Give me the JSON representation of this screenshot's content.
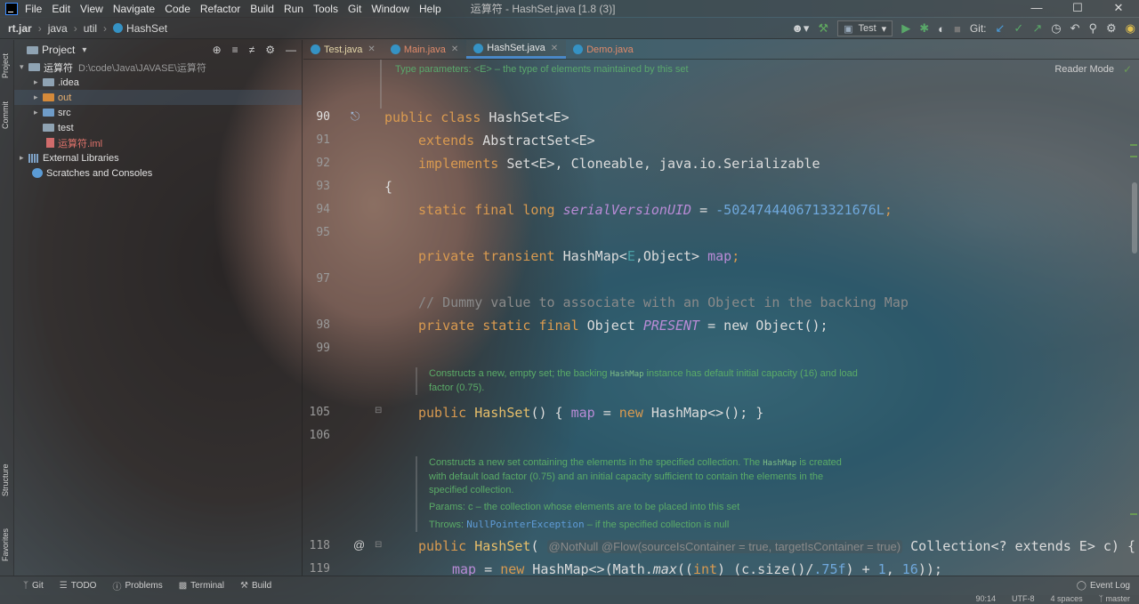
{
  "menubar": {
    "items": [
      "File",
      "Edit",
      "View",
      "Navigate",
      "Code",
      "Refactor",
      "Build",
      "Run",
      "Tools",
      "Git",
      "Window",
      "Help"
    ],
    "window_title": "运算符 - HashSet.java [1.8 (3)]"
  },
  "navbar": {
    "crumbs": [
      "rt.jar",
      "java",
      "util",
      "HashSet"
    ],
    "run_config": "Test",
    "git_label": "Git:"
  },
  "left_stripe": {
    "project": "Project",
    "commit": "Commit",
    "structure": "Structure",
    "favorites": "Favorites"
  },
  "project_panel": {
    "title": "Project",
    "root": {
      "name": "运算符",
      "path": "D:\\code\\Java\\JAVASE\\运算符"
    },
    "children": [
      ".idea",
      "out",
      "src",
      "test",
      "运算符.iml"
    ],
    "external_libraries": "External Libraries",
    "scratches": "Scratches and Consoles"
  },
  "editor_tabs": [
    {
      "label": "Test.java"
    },
    {
      "label": "Main.java"
    },
    {
      "label": "HashSet.java",
      "active": true
    },
    {
      "label": "Demo.java"
    }
  ],
  "editor": {
    "doc_header": "Type parameters: <E> – the type of elements maintained by this set",
    "reader_mode": "Reader Mode",
    "line_numbers": {
      "l1": "90",
      "l2": "91",
      "l3": "92",
      "l4": "93",
      "l5": "94",
      "l6": "95",
      "l7": "97",
      "l8": "98",
      "l9": "99",
      "l10": "105",
      "l11": "106",
      "l12": "118",
      "l13": "119"
    },
    "code": {
      "public": "public",
      "class": "class",
      "class_name": "HashSet",
      "type_param": "<E>",
      "extends": "extends",
      "abstract_set": "AbstractSet",
      "e1": "<E>",
      "implements": "implements",
      "set": "Set",
      "e2": "<E>",
      "implements_rest": ", Cloneable, java.io.Serializable",
      "brace": "{",
      "static_final_long": "static final long",
      "serial_name": "serialVersionUID",
      "equals": " = ",
      "serial_value": "-5024744406713321676L",
      "semicolon": ";",
      "private_transient": "private transient",
      "hashmap_decl": "HashMap<",
      "e3": "E",
      "object_gt": ",Object>",
      "map_name": "map",
      "comment": "// Dummy value to associate with an Object in the backing Map",
      "private_static_final": "private static final",
      "object_type": "Object",
      "present_name": "PRESENT",
      "new_object": " = new Object();",
      "ctor_public": "public",
      "ctor_name": "HashSet",
      "ctor_rest_a": "() { ",
      "ctor_map": "map",
      "ctor_rest_b": " = ",
      "ctor_new": "new",
      "ctor_rest_c": " HashMap<>(); }",
      "ctor2_name": "HashSet",
      "ctor2_anno": "@NotNull @Flow(sourceIsContainer = true, targetIsContainer = true)",
      "ctor2_rest": " Collection<? extends E> c) {",
      "line119_map": "map",
      "line119_a": " = ",
      "line119_new": "new",
      "line119_b": " HashMap<>(Math.",
      "line119_max": "max",
      "line119_c": "((",
      "line119_int": "int",
      "line119_d": ") (c.size()/",
      "line119_f": ".75f",
      "line119_e": ") + ",
      "line119_one": "1",
      "line119_g": ", ",
      "line119_sixteen": "16",
      "line119_h": "));"
    },
    "doc1": {
      "a": "Constructs a new, empty set; the backing ",
      "code": "HashMap",
      "b": " instance has default initial capacity (16) and load factor (0.75)."
    },
    "doc2": {
      "a": "Constructs a new set containing the elements in the specified collection. The ",
      "code": "HashMap",
      "b": " is created with default load factor (0.75) and an initial capacity sufficient to contain the elements in the specified collection.",
      "params": "Params: c – the collection whose elements are to be placed into this set",
      "throws_a": "Throws: ",
      "throws_link": "NullPointerException",
      "throws_b": " – if the specified collection is null"
    }
  },
  "bottom_tools": [
    "Git",
    "TODO",
    "Problems",
    "Terminal",
    "Build"
  ],
  "event_log": "Event Log",
  "status": {
    "position": "90:14",
    "encoding": "UTF-8",
    "indent": "4 spaces",
    "branch": "master"
  }
}
